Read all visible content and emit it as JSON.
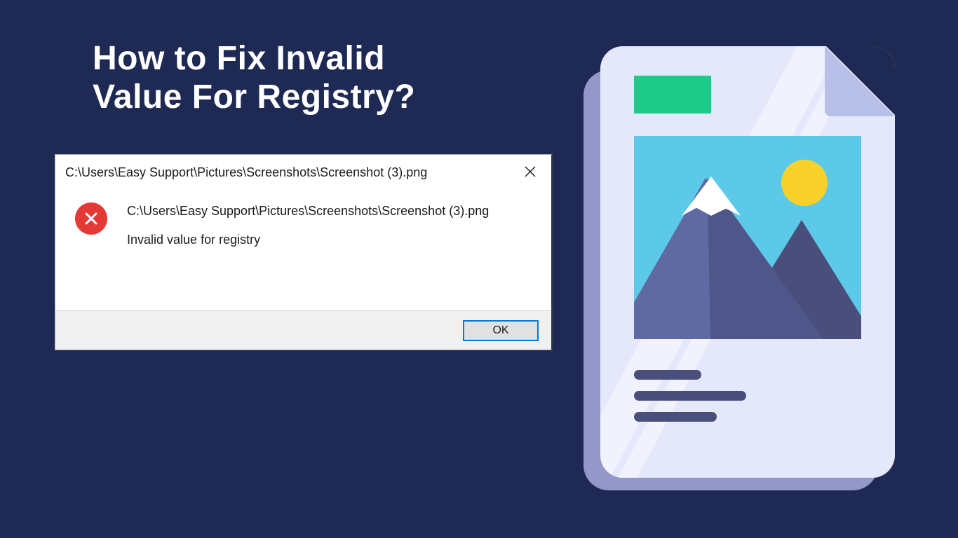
{
  "title_line1": "How to Fix Invalid",
  "title_line2": "Value For Registry?",
  "dialog": {
    "title": "C:\\Users\\Easy Support\\Pictures\\Screenshots\\Screenshot (3).png",
    "path_text": "C:\\Users\\Easy Support\\Pictures\\Screenshots\\Screenshot (3).png",
    "error_text": "Invalid value for registry",
    "ok_label": "OK"
  },
  "colors": {
    "background": "#1e2a54",
    "error_red": "#e53935",
    "green_tag": "#1bcb87",
    "ok_border": "#0078d7"
  }
}
